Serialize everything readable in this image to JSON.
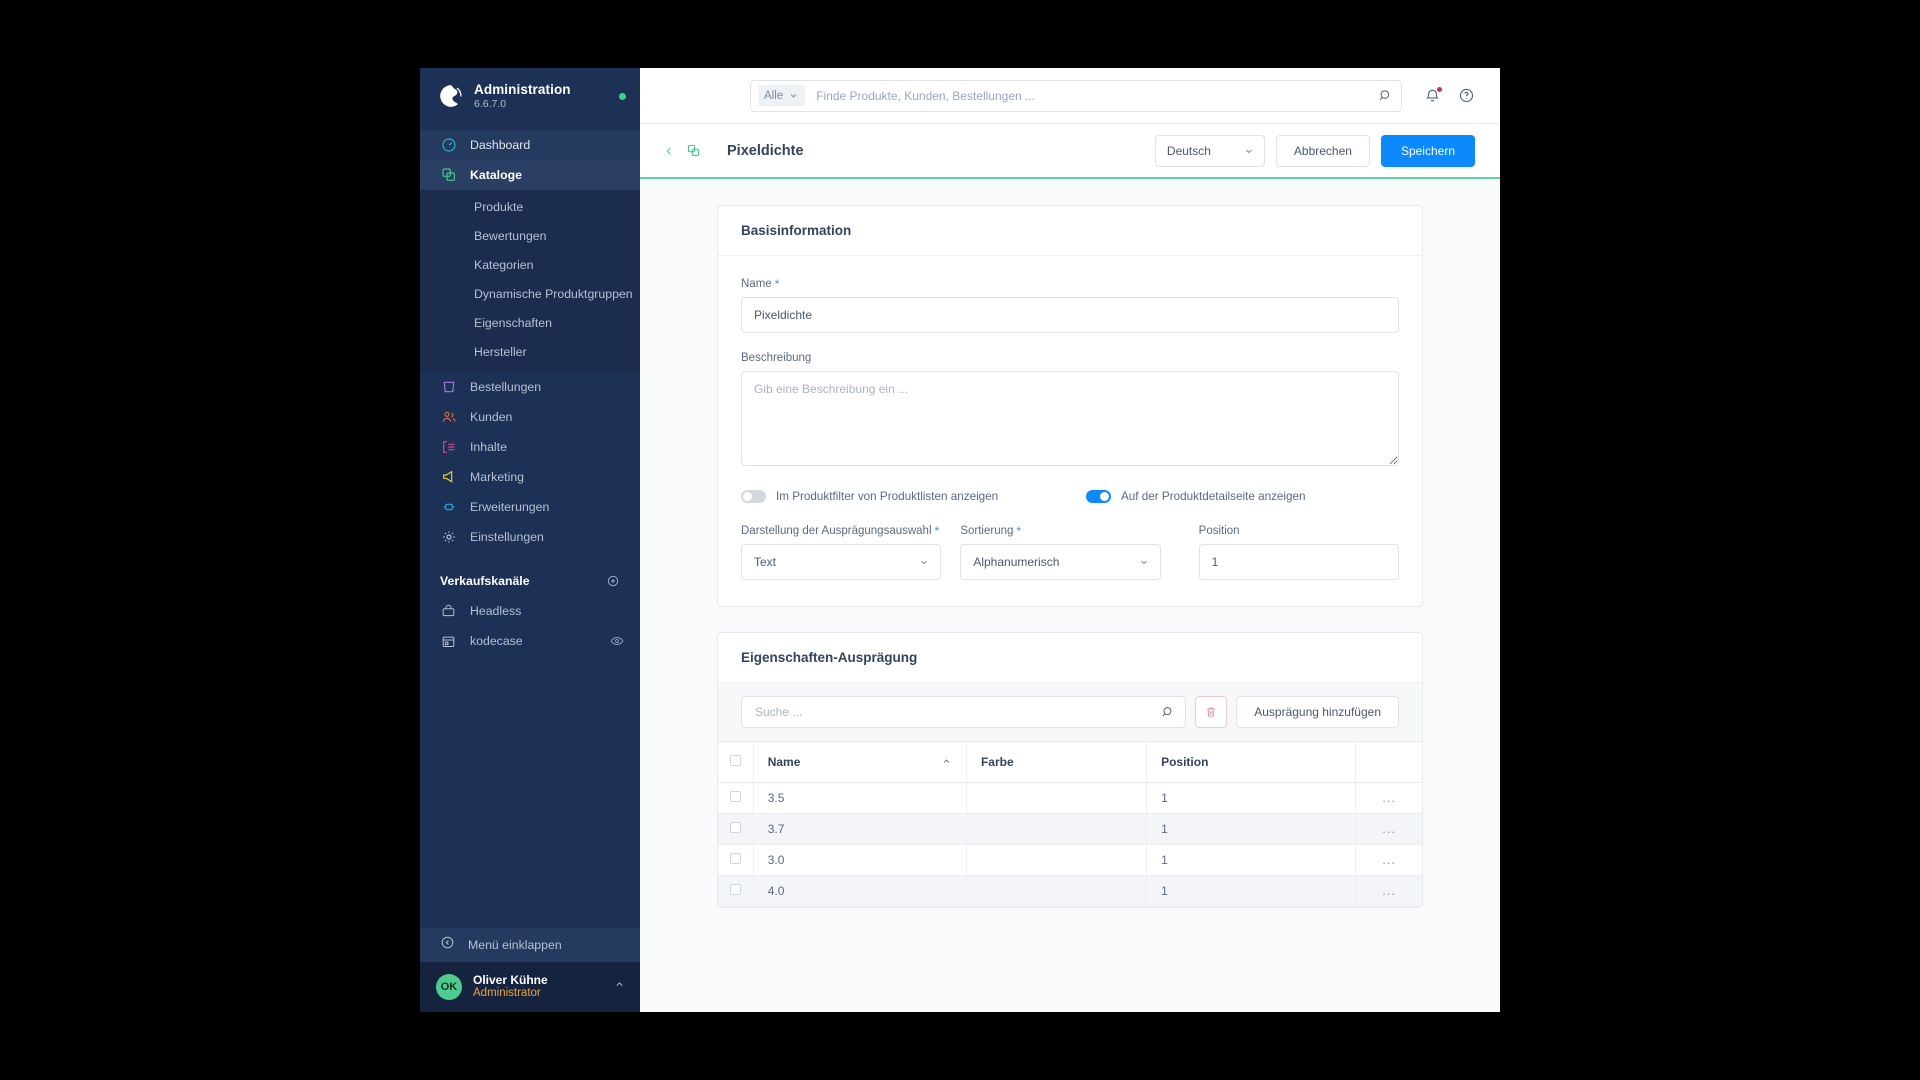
{
  "sidebar": {
    "brand": {
      "title": "Administration",
      "version": "6.6.7.0",
      "status_color": "#3ecf8e"
    },
    "items": [
      {
        "label": "Dashboard",
        "icon": "dashboard-icon"
      },
      {
        "label": "Kataloge",
        "icon": "catalog-icon"
      },
      {
        "label": "Bestellungen",
        "icon": "orders-icon"
      },
      {
        "label": "Kunden",
        "icon": "customers-icon"
      },
      {
        "label": "Inhalte",
        "icon": "content-icon"
      },
      {
        "label": "Marketing",
        "icon": "marketing-icon"
      },
      {
        "label": "Erweiterungen",
        "icon": "extensions-icon"
      },
      {
        "label": "Einstellungen",
        "icon": "settings-icon"
      }
    ],
    "catalog_children": [
      {
        "label": "Produkte"
      },
      {
        "label": "Bewertungen"
      },
      {
        "label": "Kategorien"
      },
      {
        "label": "Dynamische Produktgruppen"
      },
      {
        "label": "Eigenschaften"
      },
      {
        "label": "Hersteller"
      }
    ],
    "sales_channels": {
      "section_label": "Verkaufskanäle",
      "items": [
        {
          "label": "Headless",
          "icon": "headless-icon"
        },
        {
          "label": "kodecase",
          "icon": "storefront-icon",
          "trailing_icon": "eye-icon"
        }
      ]
    },
    "collapse_label": "Menü einklappen",
    "user": {
      "initials": "OK",
      "name": "Oliver Kühne",
      "role": "Administrator"
    }
  },
  "topbar": {
    "search": {
      "scope_label": "Alle",
      "placeholder": "Finde Produkte, Kunden, Bestellungen ..."
    },
    "notifications_has_badge": true
  },
  "pageheader": {
    "title": "Pixeldichte",
    "language": "Deutsch",
    "cancel_label": "Abbrechen",
    "save_label": "Speichern",
    "accent_color": "#5bd6a0",
    "primary_color": "#0c8afb"
  },
  "basisinformation": {
    "card_title": "Basisinformation",
    "name_label": "Name",
    "name_required": "*",
    "name_value": "Pixeldichte",
    "description_label": "Beschreibung",
    "description_value": "",
    "description_placeholder": "Gib eine Beschreibung ein ...",
    "toggle_filter_label": "Im Produktfilter von Produktlisten anzeigen",
    "toggle_filter_on": false,
    "toggle_detail_label": "Auf der Produktdetailseite anzeigen",
    "toggle_detail_on": true,
    "display_label": "Darstellung der Ausprägungsauswahl",
    "display_required": "*",
    "display_value": "Text",
    "sorting_label": "Sortierung",
    "sorting_required": "*",
    "sorting_value": "Alphanumerisch",
    "position_label": "Position",
    "position_value": "1"
  },
  "options_card": {
    "card_title": "Eigenschaften-Ausprägung",
    "search_placeholder": "Suche ...",
    "search_value": "",
    "add_button_label": "Ausprägung hinzufügen",
    "columns": [
      "Name",
      "Farbe",
      "Position"
    ],
    "sort_column": "Name",
    "sort_direction": "asc",
    "rows": [
      {
        "name": "3.5",
        "farbe": "",
        "position": "1",
        "context": "..."
      },
      {
        "name": "3.7",
        "farbe": "",
        "position": "1",
        "context": "..."
      },
      {
        "name": "3.0",
        "farbe": "",
        "position": "1",
        "context": "..."
      },
      {
        "name": "4.0",
        "farbe": "",
        "position": "1",
        "context": "..."
      }
    ]
  }
}
